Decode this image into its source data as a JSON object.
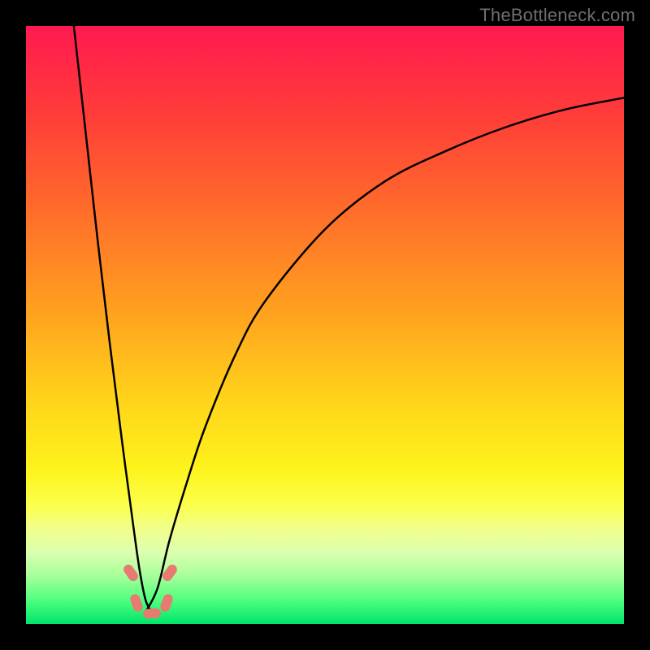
{
  "watermark": "TheBottleneck.com",
  "colors": {
    "frame": "#000000",
    "watermark": "#6f6f6f",
    "curve": "#000000",
    "marker": "#e77b71",
    "gradient_stops": [
      {
        "pct": 0,
        "color": "#ff1a50"
      },
      {
        "pct": 14,
        "color": "#ff3a3a"
      },
      {
        "pct": 30,
        "color": "#ff6a2b"
      },
      {
        "pct": 48,
        "color": "#ffa21f"
      },
      {
        "pct": 62,
        "color": "#ffd21a"
      },
      {
        "pct": 74,
        "color": "#fef31c"
      },
      {
        "pct": 80,
        "color": "#fbff4a"
      },
      {
        "pct": 84,
        "color": "#f1ff8a"
      },
      {
        "pct": 88,
        "color": "#dcffb0"
      },
      {
        "pct": 92,
        "color": "#a5ff9a"
      },
      {
        "pct": 96,
        "color": "#4fff7f"
      },
      {
        "pct": 100,
        "color": "#00e56a"
      }
    ]
  },
  "chart_data": {
    "type": "line",
    "title": "",
    "xlabel": "",
    "ylabel": "",
    "xlim": [
      0,
      100
    ],
    "ylim": [
      0,
      100
    ],
    "note": "Two bottleneck curves meeting near x≈20; y is bottleneck percentage (0 at bottom / green, 100 at top / red). Values estimated from pixels.",
    "series": [
      {
        "name": "left-curve",
        "x": [
          8,
          10,
          12,
          14,
          16,
          18,
          19,
          20,
          21
        ],
        "y": [
          100,
          82,
          64,
          47,
          31,
          16,
          9,
          4,
          2
        ]
      },
      {
        "name": "right-curve",
        "x": [
          20,
          22,
          24,
          27,
          30,
          35,
          40,
          50,
          60,
          70,
          80,
          90,
          100
        ],
        "y": [
          2,
          6,
          14,
          24,
          33,
          45,
          54,
          66,
          74,
          79,
          83,
          86,
          88
        ]
      }
    ],
    "markers": [
      {
        "x": 17.5,
        "y": 8.5
      },
      {
        "x": 18.5,
        "y": 3.5
      },
      {
        "x": 21.0,
        "y": 1.8
      },
      {
        "x": 23.5,
        "y": 3.5
      },
      {
        "x": 24.0,
        "y": 8.5
      }
    ]
  }
}
